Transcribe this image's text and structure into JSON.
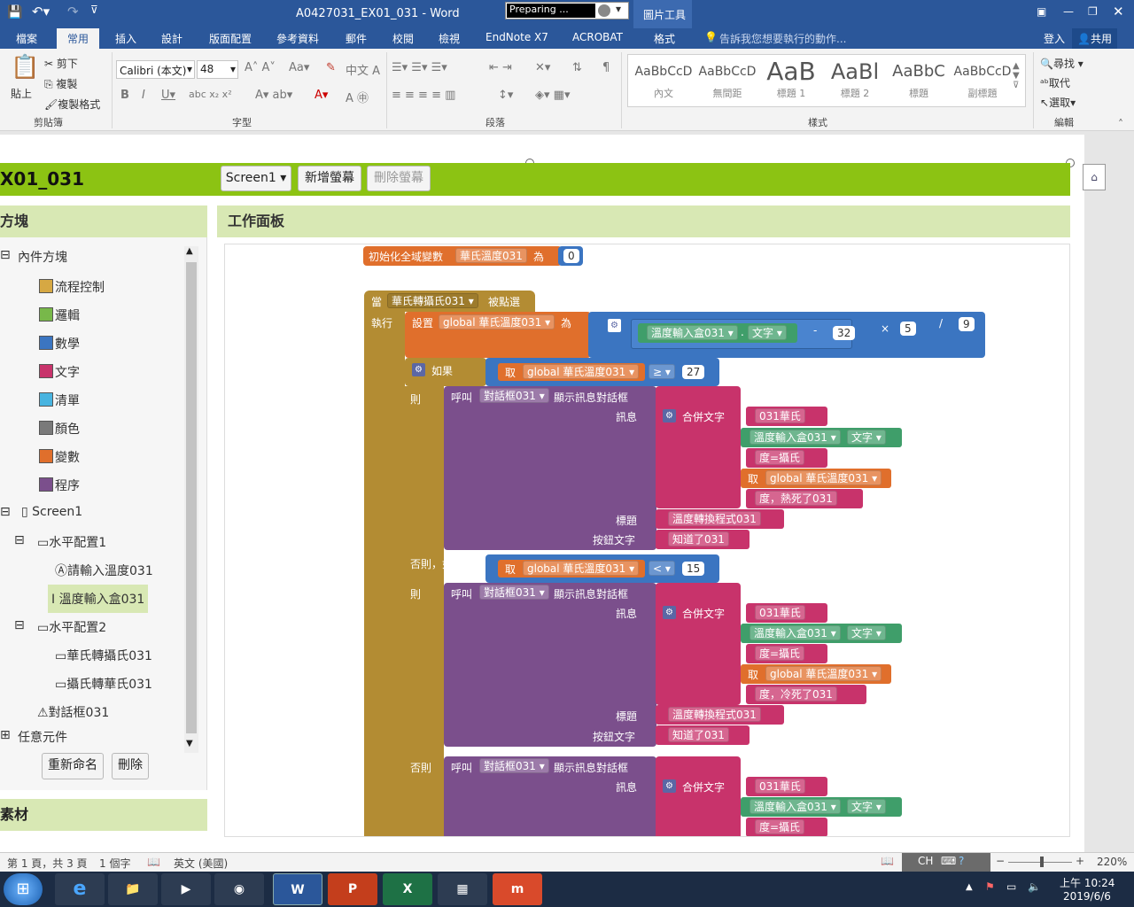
{
  "titlebar": {
    "doc_title": "A0427031_EX01_031 - Word",
    "preparing": "Preparing ...",
    "picture_tools": "圖片工具"
  },
  "ribbon_tabs": [
    "檔案",
    "常用",
    "插入",
    "設計",
    "版面配置",
    "參考資料",
    "郵件",
    "校閱",
    "檢視",
    "EndNote X7",
    "ACROBAT",
    "格式"
  ],
  "tell_me": "告訴我您想要執行的動作...",
  "signin": "登入",
  "share": "共用",
  "clipboard": {
    "paste": "貼上",
    "cut": "剪下",
    "copy": "複製",
    "format_painter": "複製格式",
    "group": "剪貼簿"
  },
  "font": {
    "name": "Calibri (本文)",
    "size": "48",
    "group": "字型"
  },
  "paragraph": {
    "group": "段落"
  },
  "styles": {
    "items": [
      {
        "preview": "AaBbCcD",
        "name": "內文"
      },
      {
        "preview": "AaBbCcD",
        "name": "無間距"
      },
      {
        "preview": "AaB",
        "name": "標題 1"
      },
      {
        "preview": "AaBl",
        "name": "標題 2"
      },
      {
        "preview": "AaBbC",
        "name": "標題"
      },
      {
        "preview": "AaBbCcD",
        "name": "副標題"
      }
    ],
    "group": "樣式"
  },
  "editing": {
    "find": "尋找",
    "replace": "取代",
    "select": "選取",
    "group": "編輯"
  },
  "app": {
    "project": "X01_031",
    "screen_select": "Screen1 ▾",
    "add_screen": "新增螢幕",
    "remove_screen": "刪除螢幕",
    "blocks_head": "方塊",
    "workspace_head": "工作面板",
    "media_head": "素材"
  },
  "tree": {
    "builtin": "內件方塊",
    "control": "流程控制",
    "logic": "邏輯",
    "math": "數學",
    "text": "文字",
    "lists": "清單",
    "colors": "顏色",
    "variables": "變數",
    "procedures": "程序",
    "screen": "Screen1",
    "hor1": "水平配置1",
    "label": "請輸入溫度031",
    "textbox": "溫度輸入盒031",
    "hor2": "水平配置2",
    "btn1": "華氏轉攝氏031",
    "btn2": "攝氏轉華氏031",
    "notifier": "對話框031",
    "any": "任意元件",
    "rename": "重新命名",
    "delete": "刪除"
  },
  "blocks": {
    "init": "初始化全域變數",
    "var": "華氏溫度031",
    "as": "為",
    "zero": "0",
    "when": "當",
    "button": "華氏轉攝氏031",
    "clicked": "被點選",
    "do": "執行",
    "set": "設置",
    "gvar": "global 華氏溫度031",
    "to": "為",
    "textbox": "溫度輸入盒031",
    "textprop": "文字",
    "minus": "-",
    "n32": "32",
    "times": "×",
    "n5": "5",
    "div": "/",
    "n9": "9",
    "if": "如果",
    "get": "取",
    "ge": "≥",
    "n27": "27",
    "then": "則",
    "call": "呼叫",
    "notifier": "對話框031",
    "show": "顯示訊息對話框",
    "message": "訊息",
    "join": "合併文字",
    "s1": "031華氏",
    "s2": "度=攝氏",
    "s3hot": "度，熱死了031",
    "title": "標題",
    "titlev": "溫度轉換程式031",
    "btntext": "按鈕文字",
    "btnv": "知道了031",
    "elseif": "否則，如果",
    "lt": "<",
    "n15": "15",
    "s3cold": "度，冷死了031",
    "else": "否則"
  },
  "status": {
    "page": "第 1 頁，共 3 頁",
    "words": "1 個字",
    "lang": "英文 (美國)",
    "zoom": "220%"
  },
  "clock": {
    "time": "上午 10:24",
    "date": "2019/6/6"
  },
  "tray": {
    "ime": "CH"
  }
}
